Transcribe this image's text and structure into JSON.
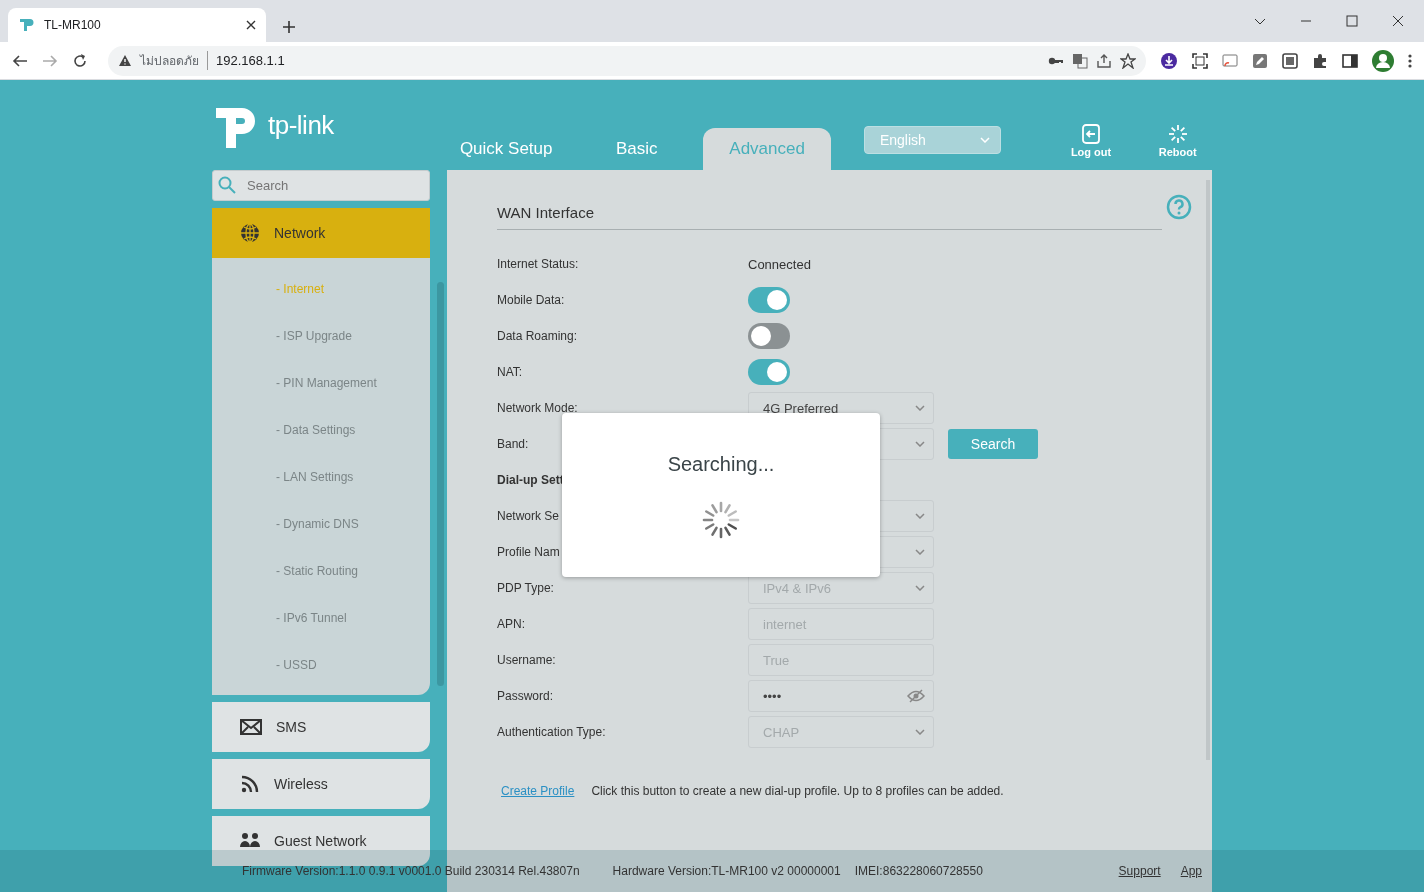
{
  "browser": {
    "tab_title": "TL-MR100",
    "security_label": "ไม่ปลอดภัย",
    "address": "192.168.1.1"
  },
  "header": {
    "logo": "tp-link",
    "tabs": [
      {
        "label": "Quick Setup",
        "selected": false
      },
      {
        "label": "Basic",
        "selected": false
      },
      {
        "label": "Advanced",
        "selected": true
      }
    ],
    "language": "English",
    "actions": [
      {
        "label": "Log out",
        "kind": "logout"
      },
      {
        "label": "Reboot",
        "kind": "reboot"
      }
    ]
  },
  "sidebar": {
    "search_placeholder": "Search",
    "sections": [
      {
        "label": "Network",
        "kind": "globe",
        "expanded": true,
        "children": [
          {
            "label": "- Internet",
            "selected": true
          },
          {
            "label": "- ISP Upgrade",
            "selected": false
          },
          {
            "label": "- PIN Management",
            "selected": false
          },
          {
            "label": "- Data Settings",
            "selected": false
          },
          {
            "label": "- LAN Settings",
            "selected": false
          },
          {
            "label": "- Dynamic DNS",
            "selected": false
          },
          {
            "label": "- Static Routing",
            "selected": false
          },
          {
            "label": "- IPv6 Tunnel",
            "selected": false
          },
          {
            "label": "- USSD",
            "selected": false
          }
        ]
      },
      {
        "label": "SMS",
        "kind": "mail",
        "expanded": false
      },
      {
        "label": "Wireless",
        "kind": "wifi",
        "expanded": false
      },
      {
        "label": "Guest Network",
        "kind": "people",
        "expanded": false
      }
    ]
  },
  "panel": {
    "title": "WAN Interface",
    "fields": [
      {
        "label": "Internet Status:",
        "kind": "text",
        "value": "Connected"
      },
      {
        "label": "Mobile Data:",
        "kind": "toggle",
        "on": true
      },
      {
        "label": "Data Roaming:",
        "kind": "toggle",
        "on": false
      },
      {
        "label": "NAT:",
        "kind": "toggle",
        "on": true
      },
      {
        "label": "Network Mode:",
        "kind": "select",
        "value": "4G Preferred",
        "disabled": false
      },
      {
        "label": "Band:",
        "kind": "select",
        "button": "Search"
      },
      {
        "label": "Dial-up Sett",
        "kind": "heading"
      },
      {
        "label": "Network Se",
        "kind": "select"
      },
      {
        "label": "Profile Nam",
        "kind": "select"
      },
      {
        "label": "PDP Type:",
        "kind": "select",
        "value": "IPv4 & IPv6",
        "disabled": true
      },
      {
        "label": "APN:",
        "kind": "input",
        "value": "internet",
        "disabled": true
      },
      {
        "label": "Username:",
        "kind": "input",
        "value": "True",
        "disabled": true
      },
      {
        "label": "Password:",
        "kind": "password",
        "value": "••••",
        "disabled": false
      },
      {
        "label": "Authentication Type:",
        "kind": "select",
        "value": "CHAP",
        "disabled": true
      }
    ],
    "link": "Create Profile",
    "note": "Click this button to create a new dial-up profile. Up to 8 profiles can be added."
  },
  "dialog": {
    "message": "Searching..."
  },
  "footer": {
    "firmware": "Firmware Version:1.1.0 0.9.1 v0001.0 Build 230314 Rel.43807n",
    "hardware": "Hardware Version:TL-MR100 v2 00000001",
    "imei": "IMEI:863228060728550",
    "links": [
      "Support",
      "App"
    ]
  }
}
